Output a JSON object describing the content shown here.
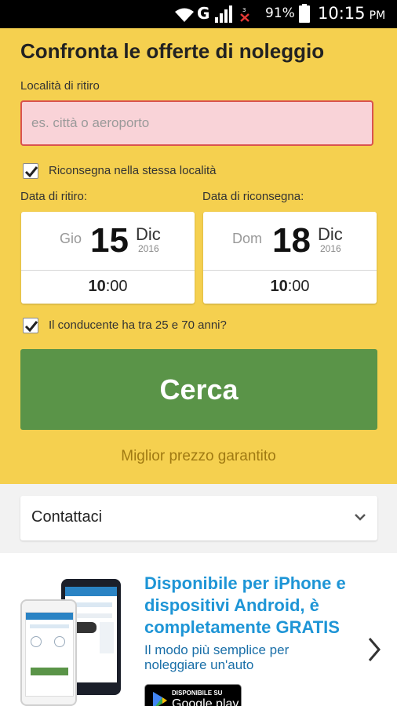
{
  "status_bar": {
    "network": "G",
    "battery_percent": "91%",
    "time": "10:15",
    "ampm": "PM"
  },
  "form": {
    "title": "Confronta le offerte di noleggio",
    "pickup_location_label": "Località di ritiro",
    "pickup_location_placeholder": "es. città o aeroporto",
    "same_location_label": "Riconsegna nella stessa località",
    "same_location_checked": true,
    "pickup_date_label": "Data di ritiro:",
    "return_date_label": "Data di riconsegna:",
    "pickup": {
      "weekday": "Gio",
      "day": "15",
      "month": "Dic",
      "year": "2016",
      "time_hour": "10",
      "time_rest": ":00"
    },
    "return": {
      "weekday": "Dom",
      "day": "18",
      "month": "Dic",
      "year": "2016",
      "time_hour": "10",
      "time_rest": ":00"
    },
    "driver_age_label": "Il conducente ha tra 25 e 70 anni?",
    "driver_age_checked": true,
    "search_button": "Cerca",
    "guarantee_text": "Miglior prezzo garantito"
  },
  "contact": {
    "label": "Contattaci"
  },
  "promo": {
    "title": "Disponibile per iPhone e dispositivi Android, è completamente GRATIS",
    "subtitle": "Il modo più semplice per noleggiare un'auto",
    "store_small": "DISPONIBILE SU",
    "store_name": "Google play"
  },
  "colors": {
    "header_bg": "#f5d04f",
    "cta_green": "#5a9448",
    "input_error_bg": "#f9d3d8",
    "input_error_border": "#d9534f",
    "promo_blue": "#1e95d6",
    "guarantee_text": "#a07a12"
  },
  "icons": [
    "wifi-icon",
    "signal-icon",
    "no-data-icon",
    "battery-icon",
    "checkbox-icon",
    "chevron-down-icon",
    "chevron-right-icon",
    "google-play-icon"
  ]
}
